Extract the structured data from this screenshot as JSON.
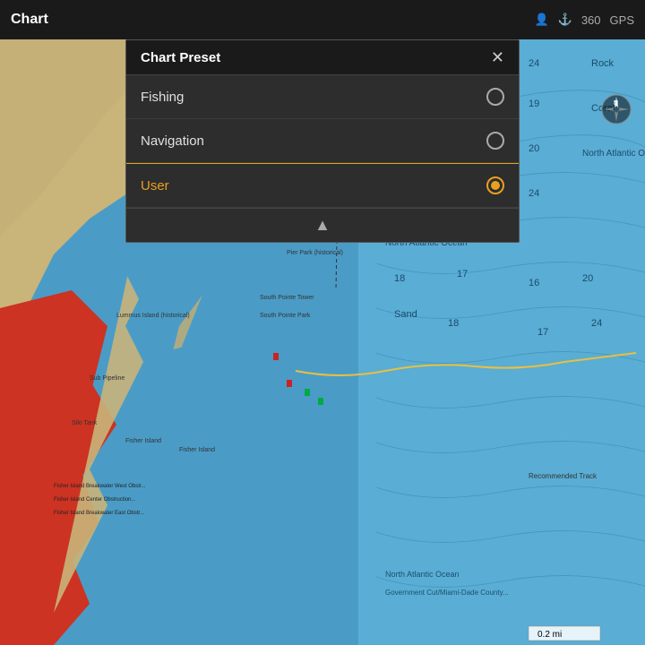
{
  "topBar": {
    "title": "Chart",
    "icons": [
      "person-icon",
      "wifi-icon",
      "360-icon",
      "gps-icon"
    ]
  },
  "dialog": {
    "title": "Chart Preset",
    "close_label": "✕",
    "items": [
      {
        "id": "fishing",
        "label": "Fishing",
        "selected": false
      },
      {
        "id": "navigation",
        "label": "Navigation",
        "selected": false
      },
      {
        "id": "user",
        "label": "User",
        "selected": true
      }
    ],
    "collapse_label": "▲"
  },
  "map": {
    "scale": "0.2 mi"
  },
  "colors": {
    "accent": "#e8a020",
    "water": "#4a9cc7",
    "land_tan": "#c9b47a",
    "land_red": "#c0392b",
    "dialog_bg": "#2d2d2d",
    "header_bg": "#1a1a1a"
  }
}
